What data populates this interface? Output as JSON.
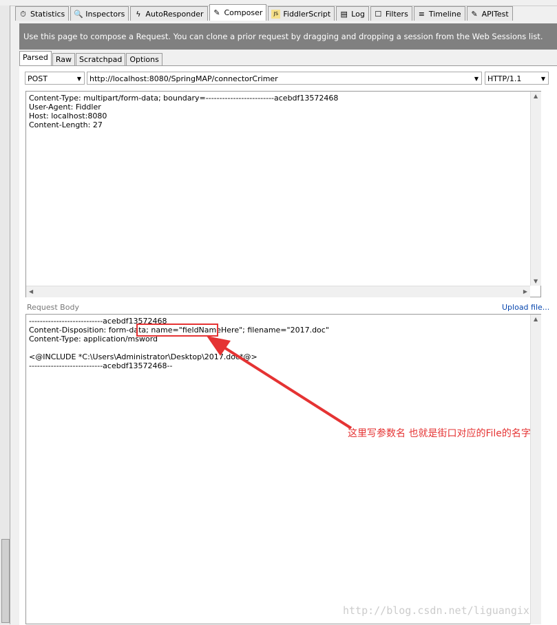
{
  "tabs": [
    {
      "label": "Statistics",
      "icon": "stopwatch-icon"
    },
    {
      "label": "Inspectors",
      "icon": "magnifier-icon"
    },
    {
      "label": "AutoResponder",
      "icon": "lightning-icon"
    },
    {
      "label": "Composer",
      "icon": "pencil-icon",
      "active": true
    },
    {
      "label": "FiddlerScript",
      "icon": "script-icon"
    },
    {
      "label": "Log",
      "icon": "document-icon"
    },
    {
      "label": "Filters",
      "icon": "checkbox-icon"
    },
    {
      "label": "Timeline",
      "icon": "timeline-icon"
    },
    {
      "label": "APITest",
      "icon": "pencil-icon"
    }
  ],
  "banner": "Use this page to compose a Request. You can clone a prior request by dragging and dropping a session from the Web Sessions list.",
  "subtabs": [
    "Parsed",
    "Raw",
    "Scratchpad",
    "Options"
  ],
  "request": {
    "method": "POST",
    "url": "http://localhost:8080/SpringMAP/connectorCrimer",
    "version": "HTTP/1.1"
  },
  "headers": "Content-Type: multipart/form-data; boundary=-------------------------acebdf13572468\nUser-Agent: Fiddler\nHost: localhost:8080\nContent-Length: 27",
  "body_label": "Request Body",
  "upload_link": "Upload file...",
  "body": "---------------------------acebdf13572468\nContent-Disposition: form-data; name=\"fieldNameHere\"; filename=\"2017.doc\"\nContent-Type: application/msword\n\n<@INCLUDE *C:\\Users\\Administrator\\Desktop\\2017.doc*@>\n---------------------------acebdf13572468--",
  "annotation": "这里写参数名 也就是街口对应的File的名字",
  "annotation_color": "#e53333",
  "watermark": "http://blog.csdn.net/liguangix"
}
